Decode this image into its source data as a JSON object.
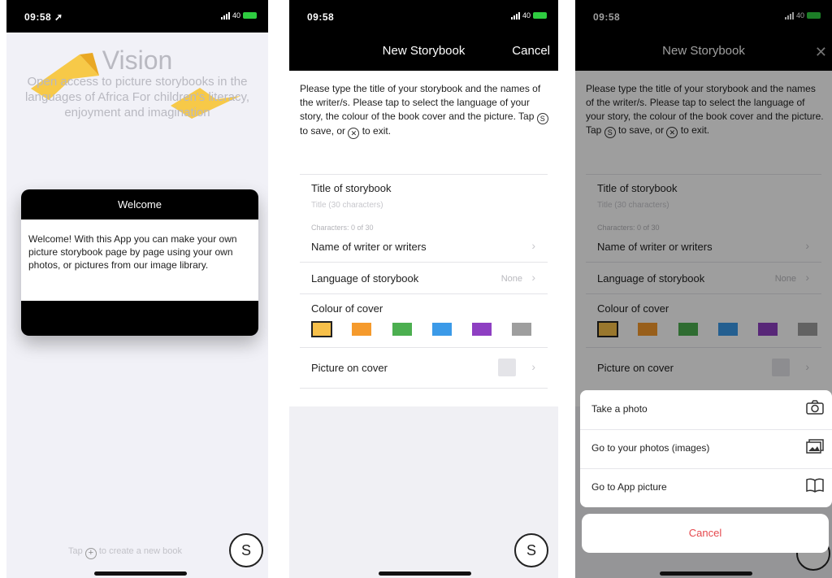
{
  "panel1": {
    "status_time": "09:58 ➚",
    "signal": "40",
    "vision_heading": "Vision",
    "vision_text": "Open access to picture storybooks in the languages of Africa For children's literacy, enjoyment and imagination",
    "dialog_title": "Welcome",
    "dialog_body": "Welcome! With this App you can make your own picture storybook page by page using your own photos, or pictures from our image library.",
    "tap_text_prefix": "Tap",
    "tap_text_suffix": "to create a new book",
    "plus_icon": "plus-circle-icon",
    "s_button": "S"
  },
  "panel2": {
    "status_time": "09:58",
    "signal": "40",
    "nav_title": "New Storybook",
    "nav_action": "Cancel",
    "instruction_1": "Please type the title of your storybook and the names of the writer/s. Please tap to select the language of your story, the colour of the book cover and the picture. Tap",
    "instruction_2": "to save, or",
    "instruction_3": "to exit.",
    "save_glyph": "S",
    "exit_glyph": "✕",
    "title_label": "Title of storybook",
    "title_placeholder": "Title (30 characters)",
    "char_counter": "Characters: 0 of 30",
    "writer_label": "Name of writer or writers",
    "language_label": "Language of storybook",
    "language_value": "None",
    "colour_label": "Colour of cover",
    "picture_label": "Picture on cover",
    "chevron": "›",
    "s_button": "S"
  },
  "panel3": {
    "status_time": "09:58",
    "signal": "40",
    "nav_title": "New Storybook",
    "close_glyph": "✕",
    "instruction_1": "Please type the title of your storybook and the names of the writer/s. Please tap to select the language of your story, the colour of the book cover and the picture. Tap",
    "instruction_2": "to save, or",
    "instruction_3": "to exit.",
    "save_glyph": "S",
    "exit_glyph": "✕",
    "title_label": "Title of storybook",
    "title_placeholder": "Title (30 characters)",
    "char_counter": "Characters: 0 of 30",
    "writer_label": "Name of writer or writers",
    "language_label": "Language of storybook",
    "language_value": "None",
    "colour_label": "Colour of cover",
    "picture_label": "Picture on cover",
    "chevron": "›",
    "option_photo": "Take a photo",
    "option_photos": "Go to your photos (images)",
    "option_app": "Go to App picture",
    "photo_icon": "camera-icon",
    "photos_icon": "images-icon",
    "app_icon": "book-icon",
    "cancel": "Cancel"
  },
  "cover_colors": [
    "#f7c04a",
    "#f59a2c",
    "#4caf50",
    "#3b9ae8",
    "#8e3fc2",
    "#9e9e9e"
  ]
}
